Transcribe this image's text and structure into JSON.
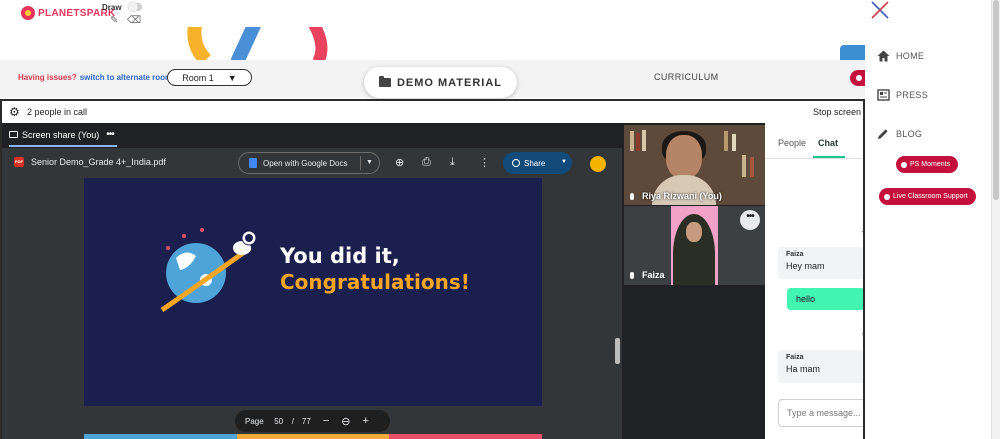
{
  "topbar": {
    "logo_text": "PLANETSPARK",
    "draw_label": "Draw"
  },
  "header": {
    "issues_text": "Having issues?",
    "switch_link": "switch to alternate room",
    "room_value": "Room 1",
    "demo_material": "DEMO MATERIAL",
    "curriculum": "CURRICULUM"
  },
  "call": {
    "people_count": "2 people in call",
    "stop_screen": "Stop screen",
    "share_tab": "Screen share (You)"
  },
  "pdf": {
    "badge": "PDF",
    "filename": "Senior Demo_Grade 4+_India.pdf",
    "open_with": "Open with Google Docs",
    "share": "Share",
    "page_label": "Page",
    "page_current": "50",
    "page_sep": "/",
    "page_total": "77"
  },
  "slide": {
    "line1": "You did it,",
    "line2": "Congratulations!"
  },
  "tiles": [
    {
      "name": "Riya Rizwani (You)"
    },
    {
      "name": "Faiza"
    }
  ],
  "chat": {
    "tab_people": "People",
    "tab_chat": "Chat",
    "messages": [
      {
        "sender": "Faiza",
        "text": "Hey mam"
      },
      {
        "sender": "",
        "text": "hello"
      },
      {
        "sender": "Faiza",
        "text": "Ha mam"
      }
    ],
    "input_placeholder": "Type a message..."
  },
  "menu": {
    "items": [
      {
        "label": "HOME",
        "icon": "home-icon"
      },
      {
        "label": "PRESS",
        "icon": "newspaper-icon"
      },
      {
        "label": "BLOG",
        "icon": "pencil-icon"
      }
    ],
    "ps_moments": "PS Moments",
    "live_support": "Live Classroom Support"
  },
  "colors": {
    "brand_red": "#c4103c",
    "accent_green": "#42f5b0",
    "slide_bg": "#1b1f4e",
    "slide_orange": "#f6a623"
  }
}
